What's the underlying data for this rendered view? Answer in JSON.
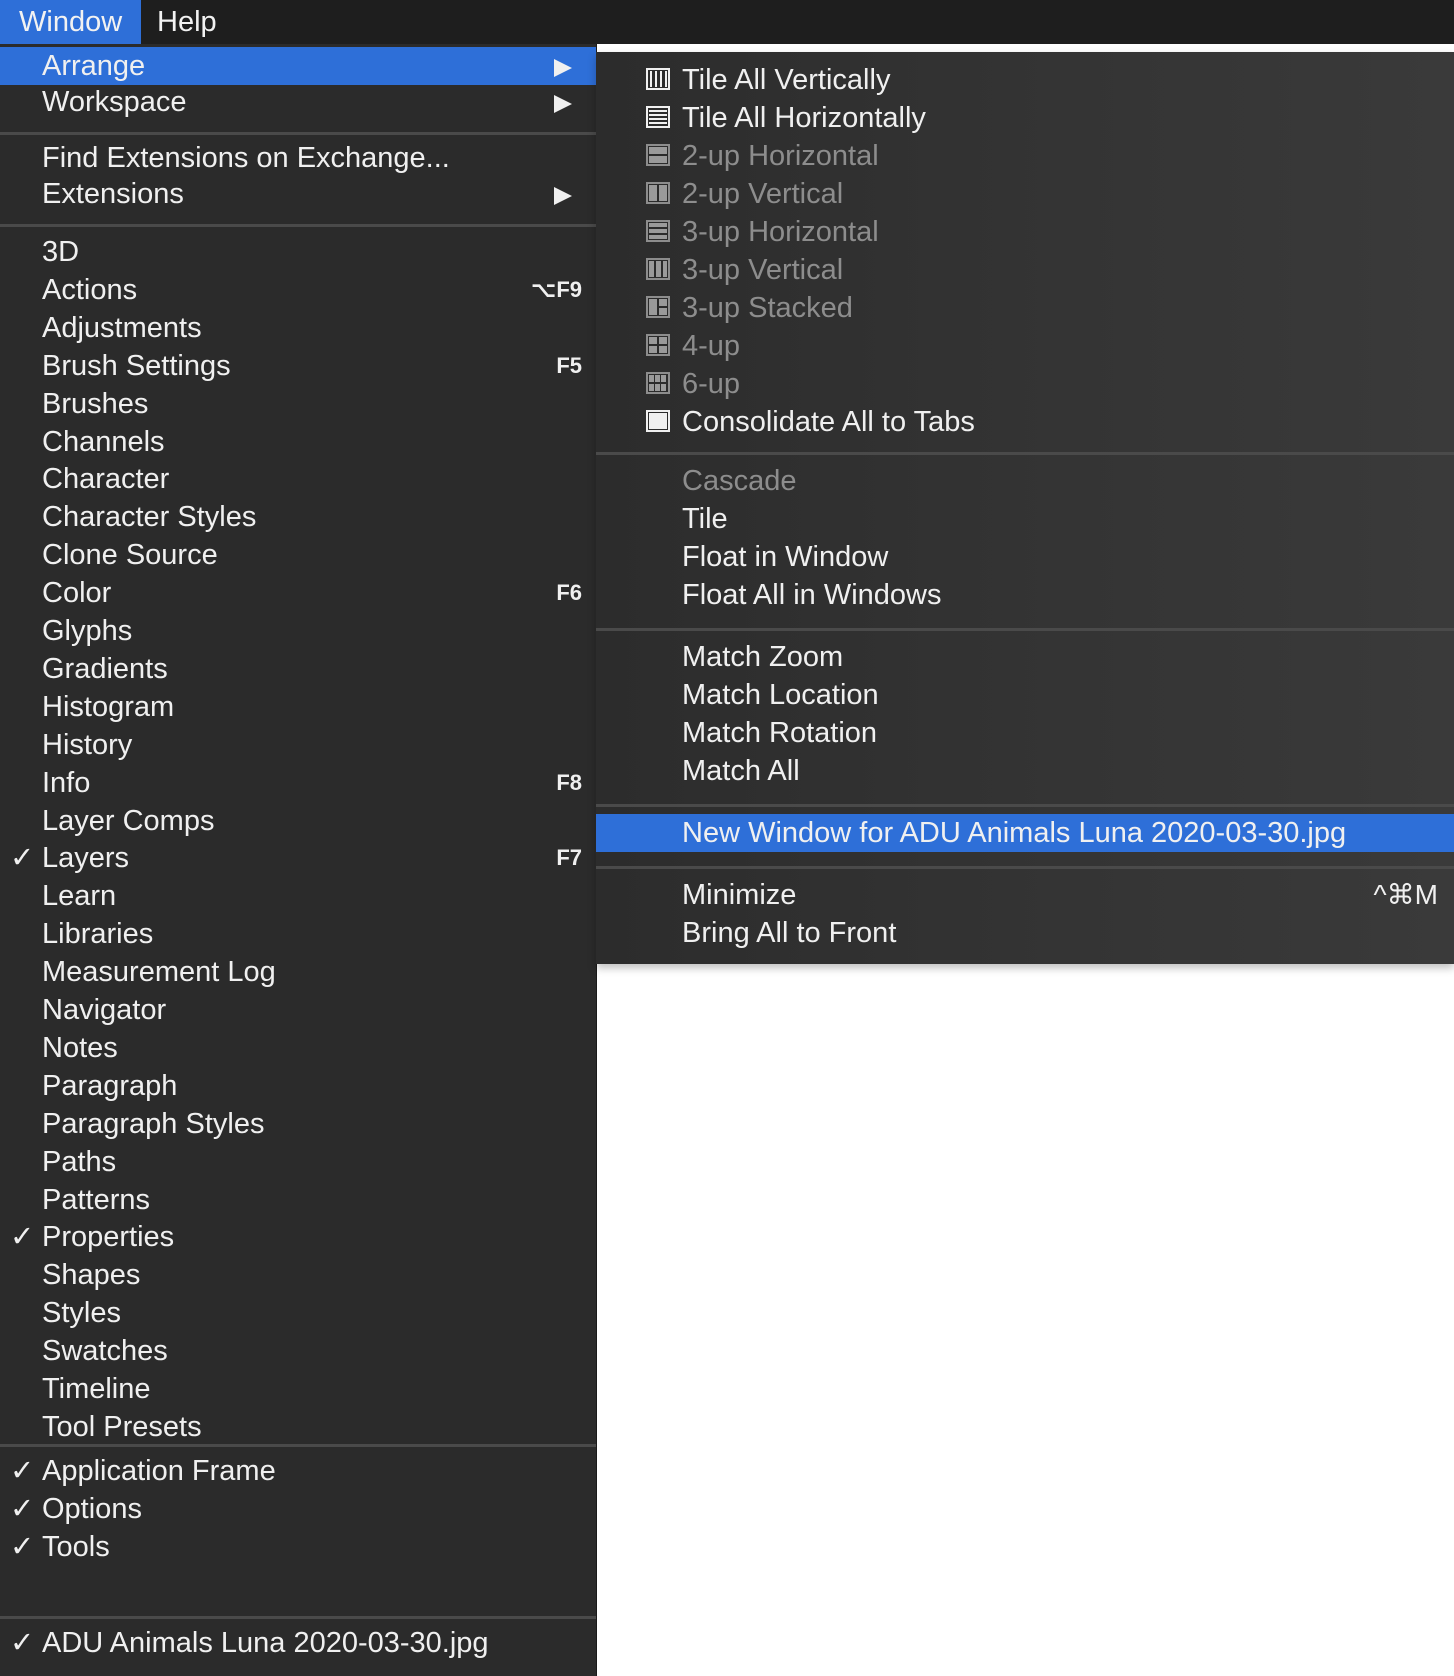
{
  "menubar": {
    "items": [
      {
        "label": "Window",
        "active": true
      },
      {
        "label": "Help",
        "active": false
      }
    ]
  },
  "main_menu": {
    "top_items": [
      {
        "label": "Arrange",
        "submenu": true,
        "highlighted": true
      },
      {
        "label": "Workspace",
        "submenu": true
      }
    ],
    "ext_items": [
      {
        "label": "Find Extensions on Exchange..."
      },
      {
        "label": "Extensions",
        "submenu": true
      }
    ],
    "panels": [
      {
        "label": "3D",
        "shortcut": "",
        "checked": false
      },
      {
        "label": "Actions",
        "shortcut": "⌥F9",
        "checked": false
      },
      {
        "label": "Adjustments",
        "shortcut": "",
        "checked": false
      },
      {
        "label": "Brush Settings",
        "shortcut": "F5",
        "checked": false
      },
      {
        "label": "Brushes",
        "shortcut": "",
        "checked": false
      },
      {
        "label": "Channels",
        "shortcut": "",
        "checked": false
      },
      {
        "label": "Character",
        "shortcut": "",
        "checked": false
      },
      {
        "label": "Character Styles",
        "shortcut": "",
        "checked": false
      },
      {
        "label": "Clone Source",
        "shortcut": "",
        "checked": false
      },
      {
        "label": "Color",
        "shortcut": "F6",
        "checked": false
      },
      {
        "label": "Glyphs",
        "shortcut": "",
        "checked": false
      },
      {
        "label": "Gradients",
        "shortcut": "",
        "checked": false
      },
      {
        "label": "Histogram",
        "shortcut": "",
        "checked": false
      },
      {
        "label": "History",
        "shortcut": "",
        "checked": false
      },
      {
        "label": "Info",
        "shortcut": "F8",
        "checked": false
      },
      {
        "label": "Layer Comps",
        "shortcut": "",
        "checked": false
      },
      {
        "label": "Layers",
        "shortcut": "F7",
        "checked": true
      },
      {
        "label": "Learn",
        "shortcut": "",
        "checked": false
      },
      {
        "label": "Libraries",
        "shortcut": "",
        "checked": false
      },
      {
        "label": "Measurement Log",
        "shortcut": "",
        "checked": false
      },
      {
        "label": "Navigator",
        "shortcut": "",
        "checked": false
      },
      {
        "label": "Notes",
        "shortcut": "",
        "checked": false
      },
      {
        "label": "Paragraph",
        "shortcut": "",
        "checked": false
      },
      {
        "label": "Paragraph Styles",
        "shortcut": "",
        "checked": false
      },
      {
        "label": "Paths",
        "shortcut": "",
        "checked": false
      },
      {
        "label": "Patterns",
        "shortcut": "",
        "checked": false
      },
      {
        "label": "Properties",
        "shortcut": "",
        "checked": true
      },
      {
        "label": "Shapes",
        "shortcut": "",
        "checked": false
      },
      {
        "label": "Styles",
        "shortcut": "",
        "checked": false
      },
      {
        "label": "Swatches",
        "shortcut": "",
        "checked": false
      },
      {
        "label": "Timeline",
        "shortcut": "",
        "checked": false
      },
      {
        "label": "Tool Presets",
        "shortcut": "",
        "checked": false
      }
    ],
    "frame_items": [
      {
        "label": "Application Frame",
        "checked": true
      },
      {
        "label": "Options",
        "checked": true
      },
      {
        "label": "Tools",
        "checked": true
      }
    ],
    "documents": [
      {
        "label": "ADU Animals Luna 2020-03-30.jpg",
        "checked": true
      }
    ],
    "check_glyph": "✓"
  },
  "arrange_menu": {
    "layout_items": [
      {
        "label": "Tile All Vertically",
        "icon": "tile-vertical-icon",
        "disabled": false
      },
      {
        "label": "Tile All Horizontally",
        "icon": "tile-horizontal-icon",
        "disabled": false
      },
      {
        "label": "2-up Horizontal",
        "icon": "2up-horizontal-icon",
        "disabled": true
      },
      {
        "label": "2-up Vertical",
        "icon": "2up-vertical-icon",
        "disabled": true
      },
      {
        "label": "3-up Horizontal",
        "icon": "3up-horizontal-icon",
        "disabled": true
      },
      {
        "label": "3-up Vertical",
        "icon": "3up-vertical-icon",
        "disabled": true
      },
      {
        "label": "3-up Stacked",
        "icon": "3up-stacked-icon",
        "disabled": true
      },
      {
        "label": "4-up",
        "icon": "4up-icon",
        "disabled": true
      },
      {
        "label": "6-up",
        "icon": "6up-icon",
        "disabled": true
      },
      {
        "label": "Consolidate All to Tabs",
        "icon": "consolidate-tabs-icon",
        "disabled": false
      }
    ],
    "float_items": [
      {
        "label": "Cascade",
        "disabled": true
      },
      {
        "label": "Tile",
        "disabled": false
      },
      {
        "label": "Float in Window",
        "disabled": false
      },
      {
        "label": "Float All in Windows",
        "disabled": false
      }
    ],
    "match_items": [
      {
        "label": "Match Zoom"
      },
      {
        "label": "Match Location"
      },
      {
        "label": "Match Rotation"
      },
      {
        "label": "Match All"
      }
    ],
    "new_window": {
      "label": "New Window for ADU Animals Luna 2020-03-30.jpg",
      "highlighted": true
    },
    "window_items": [
      {
        "label": "Minimize",
        "shortcut": "^⌘M"
      },
      {
        "label": "Bring All to Front",
        "shortcut": ""
      }
    ]
  },
  "colors": {
    "highlight": "#2e6fd8",
    "menu_bg": "#2b2b2b",
    "menubar_bg": "#1e1e1e",
    "text": "#f0f0f0",
    "disabled_text": "#8d8d8d"
  }
}
